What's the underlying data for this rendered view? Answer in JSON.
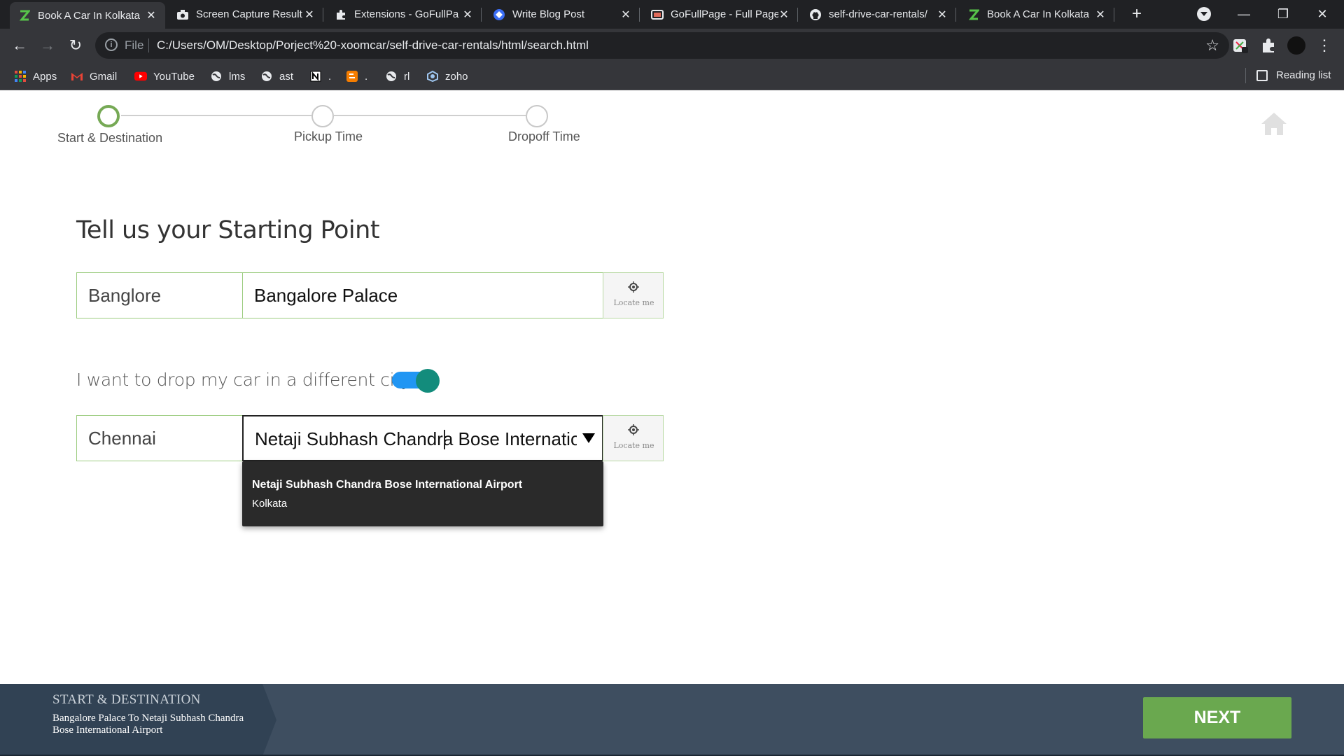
{
  "browser": {
    "tabs": [
      {
        "title": "Book A Car In Kolkata",
        "icon": "zoomcar-z-icon",
        "active": true
      },
      {
        "title": "Screen Capture Result",
        "icon": "camera-icon",
        "active": false
      },
      {
        "title": "Extensions - GoFullPa",
        "icon": "puzzle-icon",
        "active": false
      },
      {
        "title": "Write Blog Post",
        "icon": "blog-diamond-icon",
        "active": false
      },
      {
        "title": "GoFullPage - Full Page",
        "icon": "gofullpage-icon",
        "active": false
      },
      {
        "title": "self-drive-car-rentals/",
        "icon": "github-icon",
        "active": false
      },
      {
        "title": "Book A Car In Kolkata",
        "icon": "zoomcar-z-icon",
        "active": false
      }
    ],
    "omnibox": {
      "scheme": "File",
      "url": "C:/Users/OM/Desktop/Porject%20-xoomcar/self-drive-car-rentals/html/search.html"
    },
    "bookmarks": [
      {
        "label": "Apps",
        "icon": "apps-grid-icon"
      },
      {
        "label": "Gmail",
        "icon": "gmail-icon"
      },
      {
        "label": "YouTube",
        "icon": "youtube-icon"
      },
      {
        "label": "lms",
        "icon": "globe-icon"
      },
      {
        "label": "ast",
        "icon": "globe-icon"
      },
      {
        "label": ".",
        "icon": "notion-icon"
      },
      {
        "label": ".",
        "icon": "blogger-icon"
      },
      {
        "label": "rl",
        "icon": "globe-icon"
      },
      {
        "label": "zoho",
        "icon": "zoho-icon"
      }
    ],
    "reading_list": "Reading list"
  },
  "stepper": {
    "steps": [
      {
        "label": "Start & Destination",
        "active": true
      },
      {
        "label": "Pickup Time",
        "active": false
      },
      {
        "label": "Dropoff Time",
        "active": false
      }
    ]
  },
  "form": {
    "heading": "Tell us your Starting Point",
    "start": {
      "city": "Banglore",
      "place": "Bangalore Palace",
      "locate_label": "Locate me"
    },
    "drop_toggle": {
      "label": "I want to drop my car in a different city",
      "on": true
    },
    "drop": {
      "city": "Chennai",
      "place": "Netaji Subhash Chandra Bose Internation",
      "locate_label": "Locate me"
    },
    "suggestion": {
      "title": "Netaji Subhash Chandra Bose International Airport",
      "subtitle": "Kolkata"
    }
  },
  "footer": {
    "summary_heading": "START & DESTINATION",
    "summary_body": "Bangalore Palace To Netaji Subhash Chandra Bose International Airport",
    "next_label": "NEXT"
  },
  "colors": {
    "accent_green": "#6aa84f",
    "step_active": "#76a955",
    "toggle_track": "#2196f3",
    "toggle_knob": "#138c7c",
    "footer_bg": "#3e4e60"
  }
}
